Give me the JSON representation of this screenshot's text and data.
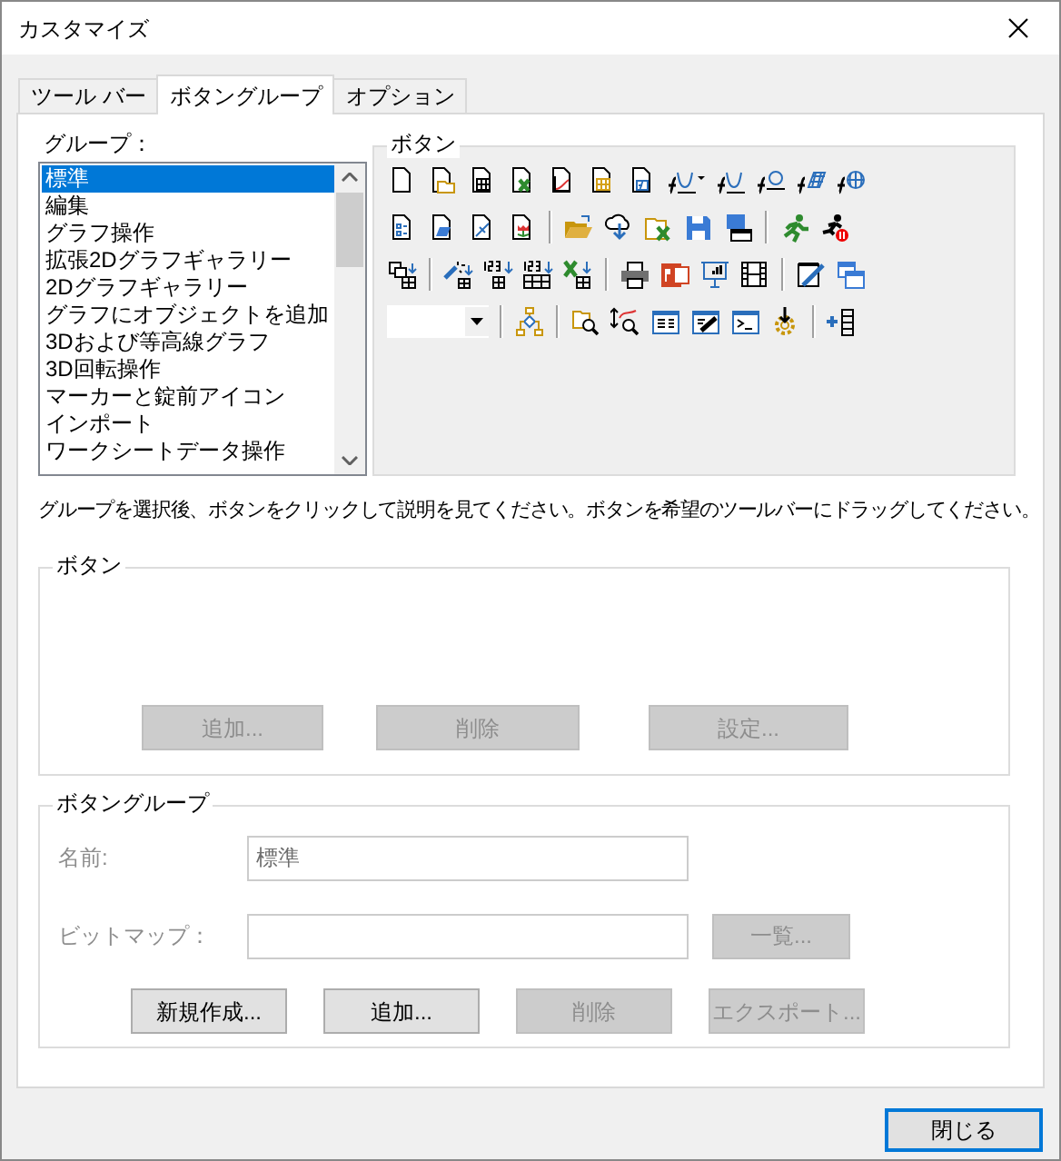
{
  "window": {
    "title": "カスタマイズ"
  },
  "tabs": [
    {
      "label": "ツール バー",
      "selected": false
    },
    {
      "label": "ボタングループ",
      "selected": true
    },
    {
      "label": "オプション",
      "selected": false
    }
  ],
  "groups": {
    "label": "グループ：",
    "items": [
      {
        "label": "標準",
        "selected": true
      },
      {
        "label": "編集",
        "selected": false
      },
      {
        "label": "グラフ操作",
        "selected": false
      },
      {
        "label": "拡張2Dグラフギャラリー",
        "selected": false
      },
      {
        "label": "2Dグラフギャラリー",
        "selected": false
      },
      {
        "label": "グラフにオブジェクトを追加",
        "selected": false
      },
      {
        "label": "3Dおよび等高線グラフ",
        "selected": false
      },
      {
        "label": "3D回転操作",
        "selected": false
      },
      {
        "label": "マーカーと錠前アイコン",
        "selected": false
      },
      {
        "label": "インポート",
        "selected": false
      },
      {
        "label": "ワークシートデータ操作",
        "selected": false
      }
    ]
  },
  "button_palette": {
    "label": "ボタン"
  },
  "hint": "グループを選択後、ボタンをクリックして説明を見てください。ボタンを希望のツールバーにドラッグしてください。",
  "button_box": {
    "label": "ボタン",
    "buttons": [
      {
        "label": "追加...",
        "disabled": true
      },
      {
        "label": "削除",
        "disabled": true
      },
      {
        "label": "設定...",
        "disabled": true
      }
    ]
  },
  "button_group": {
    "label": "ボタングループ",
    "name_field": {
      "label": "名前:",
      "value": "標準",
      "disabled": true
    },
    "bitmap_field": {
      "label": "ビットマップ：",
      "disabled": true
    },
    "browse_button": {
      "label": "一覧...",
      "disabled": true
    },
    "actions": [
      {
        "label": "新規作成...",
        "disabled": false
      },
      {
        "label": "追加...",
        "disabled": false
      },
      {
        "label": "削除",
        "disabled": true
      },
      {
        "label": "エクスポート...",
        "disabled": true
      }
    ]
  },
  "close_button": {
    "label": "閉じる"
  }
}
